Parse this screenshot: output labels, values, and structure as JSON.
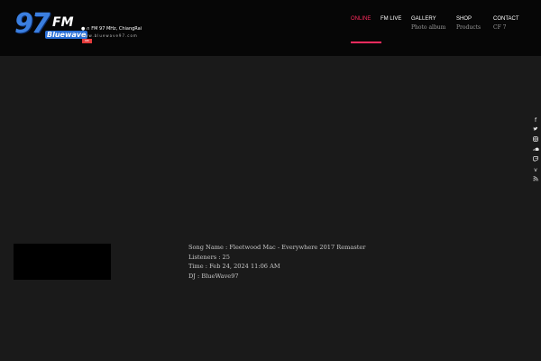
{
  "brand": {
    "number": "97",
    "fm": "FM",
    "name": "Bluewave",
    "frequency": "FM 97 MHz, ChiangRai",
    "url": "www.bluewave97.com",
    "badge": "RB"
  },
  "nav": {
    "items": [
      {
        "label": "ONLINE",
        "sub": "",
        "active": true
      },
      {
        "label": "FM LIVE",
        "sub": ""
      },
      {
        "label": "GALLERY",
        "sub": "Photo album"
      },
      {
        "label": "SHOP",
        "sub": "Products"
      },
      {
        "label": "CONTACT",
        "sub": "CF 7"
      }
    ],
    "accent_color": "#ff2b5e"
  },
  "social": [
    "facebook-icon",
    "twitter-icon",
    "instagram-icon",
    "soundcloud-icon",
    "twitch-icon",
    "vimeo-icon",
    "rss-icon"
  ],
  "now_playing": {
    "song": "Song Name : Fleetwood Mac - Everywhere 2017 Remaster",
    "listeners": "Listeners : 25",
    "time": "Time : Feb 24, 2024 11:06 AM",
    "dj": "DJ : BlueWave97"
  }
}
